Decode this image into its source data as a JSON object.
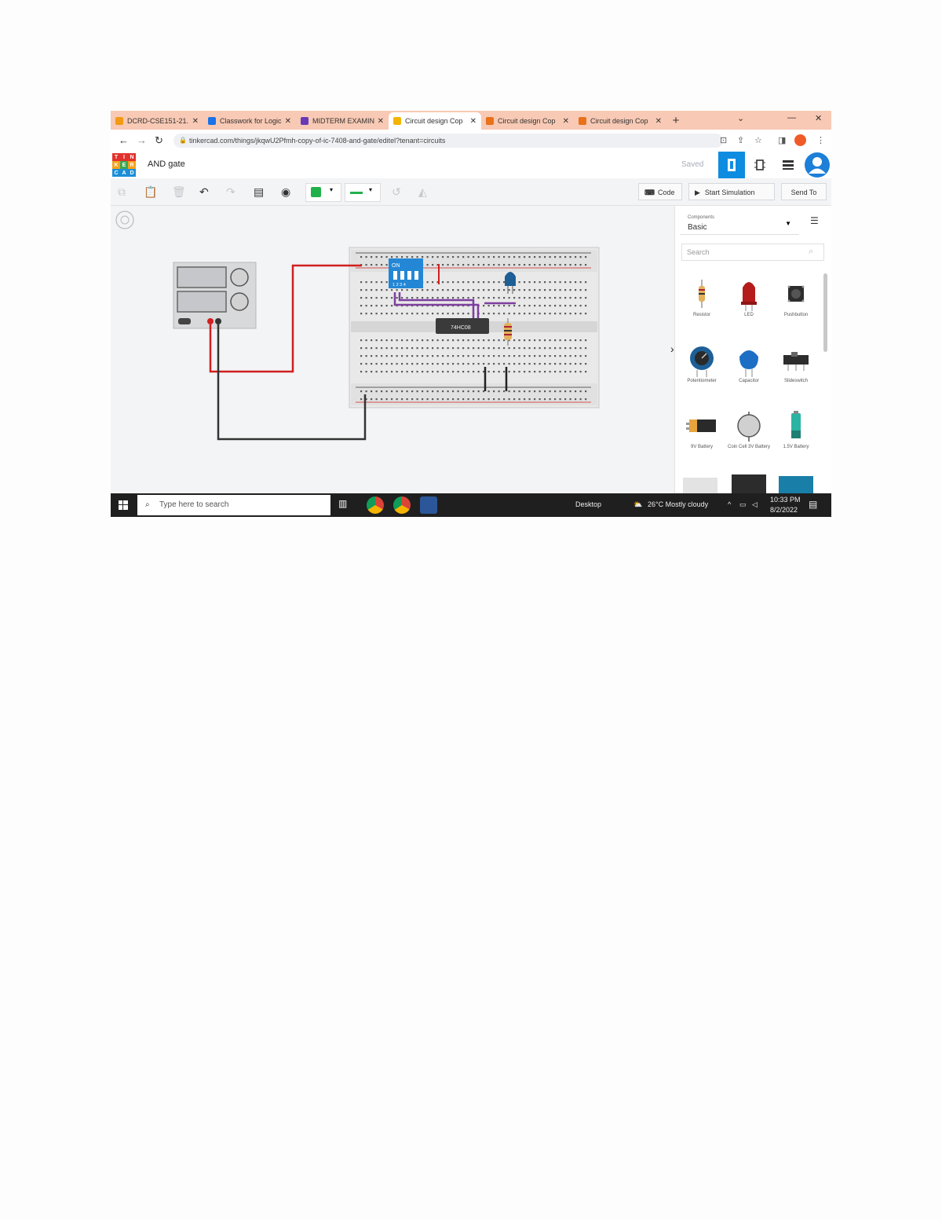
{
  "browser": {
    "tabs": [
      {
        "label": "DCRD-CSE151-21.",
        "color": "#f29a13",
        "active": false
      },
      {
        "label": "Classwork for Logic",
        "color": "#1a73e8",
        "active": false
      },
      {
        "label": "MIDTERM EXAMIN",
        "color": "#673ab7",
        "active": false
      },
      {
        "label": "Circuit design Cop",
        "color": "#f4b400",
        "active": true
      },
      {
        "label": "Circuit design Cop",
        "color": "#e8711a",
        "active": false
      },
      {
        "label": "Circuit design Cop",
        "color": "#e8711a",
        "active": false
      }
    ],
    "new_tab": "+",
    "url": "tinkercad.com/things/jkqwU2Pfmh-copy-of-ic-7408-and-gate/editel?tenant=circuits",
    "window_controls": [
      "⌄",
      "—",
      "✕"
    ]
  },
  "app": {
    "logo_letters": [
      "T",
      "I",
      "N",
      "K",
      "E",
      "R",
      "C",
      "A",
      "D"
    ],
    "logo_colors": [
      "#e2312c",
      "#e2312c",
      "#e2312c",
      "#f6a21a",
      "#3aa853",
      "#f6a21a",
      "#1c8ed8",
      "#1c8ed8",
      "#1c8ed8"
    ],
    "title": "AND gate",
    "saved": "Saved",
    "accent": "#0e8de0"
  },
  "toolbar": {
    "code_label": "Code",
    "start_label": "Start Simulation",
    "send_label": "Send To",
    "fill_color": "#21b14a",
    "line_color": "#21b14a"
  },
  "canvas": {
    "chip_label": "74HC08",
    "dip_label": "ON",
    "dip_numbers": "1 2 3 4"
  },
  "panel": {
    "components_label": "Components",
    "components_value": "Basic",
    "search_placeholder": "Search",
    "items": [
      {
        "name": "Resistor"
      },
      {
        "name": "LED"
      },
      {
        "name": "Pushbutton"
      },
      {
        "name": "Potentiometer"
      },
      {
        "name": "Capacitor"
      },
      {
        "name": "Slideswitch"
      },
      {
        "name": "9V Battery"
      },
      {
        "name": "Coin Cell 3V Battery"
      },
      {
        "name": "1.5V Battery"
      }
    ]
  },
  "taskbar": {
    "search_placeholder": "Type here to search",
    "desktop": "Desktop",
    "weather": "26°C  Mostly cloudy",
    "time": "10:33 PM",
    "date": "8/2/2022"
  }
}
